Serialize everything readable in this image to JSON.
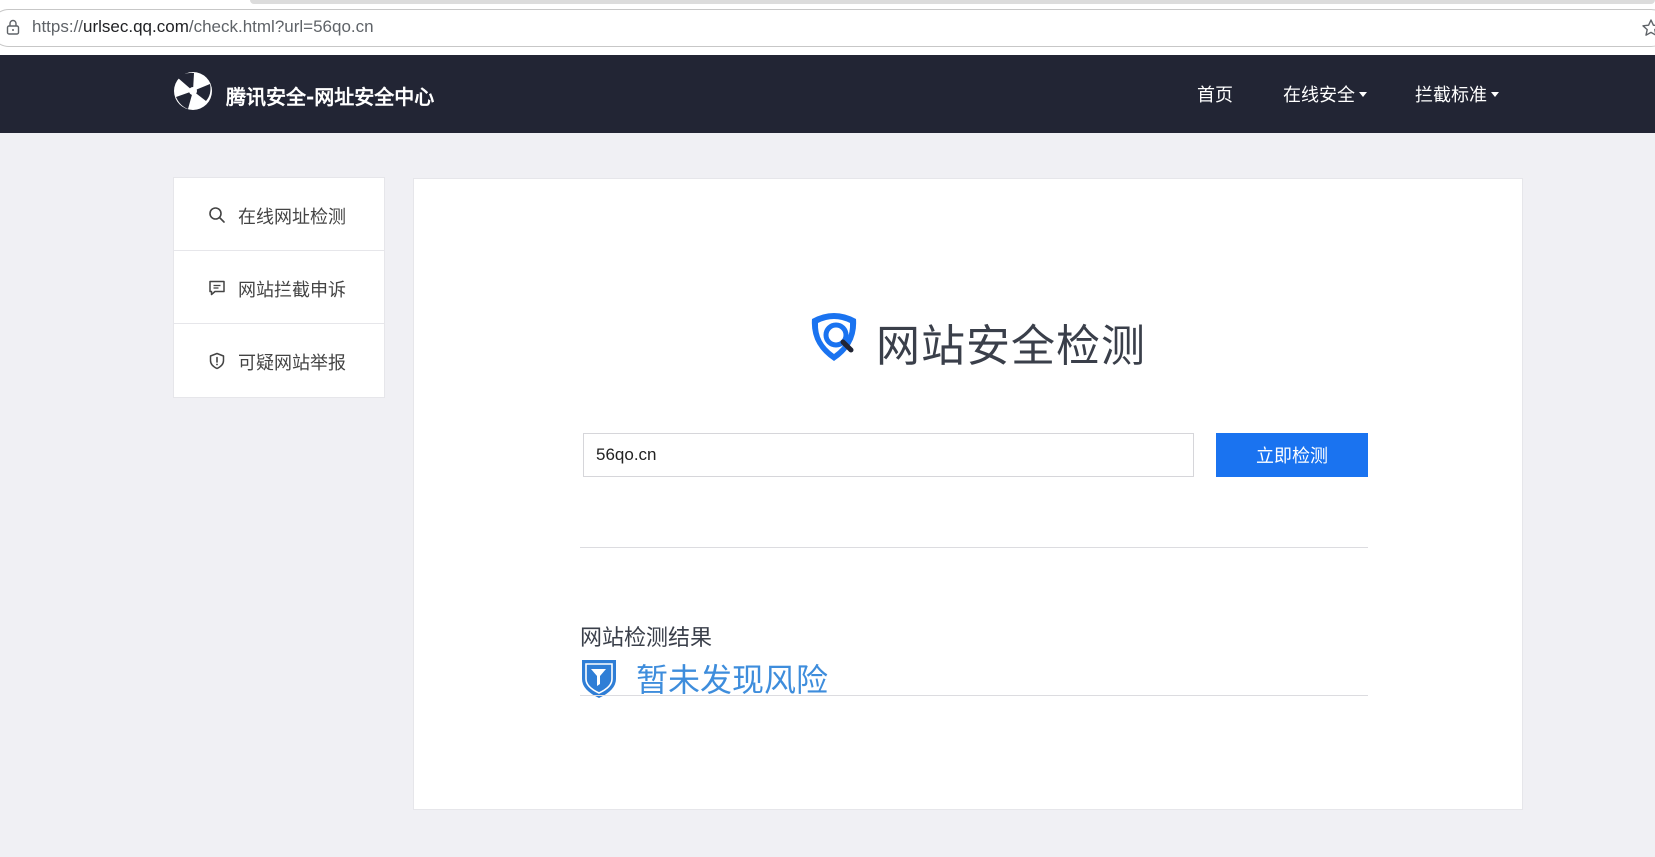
{
  "browser": {
    "url_scheme": "https://",
    "url_host": "urlsec.qq.com",
    "url_path": "/check.html?url=56qo.cn"
  },
  "header": {
    "site_title": "腾讯安全-网址安全中心",
    "nav": [
      {
        "label": "首页",
        "has_dropdown": false
      },
      {
        "label": "在线安全",
        "has_dropdown": true
      },
      {
        "label": "拦截标准",
        "has_dropdown": true
      }
    ]
  },
  "sidebar": {
    "items": [
      {
        "label": "在线网址检测",
        "icon": "search-icon"
      },
      {
        "label": "网站拦截申诉",
        "icon": "comment-icon"
      },
      {
        "label": "可疑网站举报",
        "icon": "shield-alert-icon"
      }
    ]
  },
  "main": {
    "hero_title": "网站安全检测",
    "input_value": "56qo.cn",
    "check_button": "立即检测",
    "result_title": "网站检测结果",
    "result_text": "暂未发现风险"
  },
  "colors": {
    "header_bg": "#222534",
    "primary_button": "#1a73f0",
    "result_text": "#3e8ddc",
    "page_bg": "#f0f0f4"
  }
}
